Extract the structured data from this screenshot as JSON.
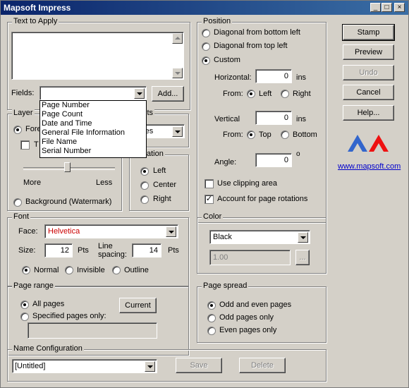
{
  "window": {
    "title": "Mapsoft Impress",
    "minimize_glyph": "_",
    "maximize_glyph": "□",
    "close_glyph": "×"
  },
  "text_to_apply": {
    "label": "Text to Apply",
    "value": ""
  },
  "fields": {
    "label": "Fields:",
    "value": "",
    "add_label": "Add...",
    "options": [
      "Page Number",
      "Page Count",
      "Date and Time",
      "General File Information",
      "File Name",
      "Serial Number"
    ]
  },
  "layer": {
    "label": "Layer",
    "foreground_label": "Fore",
    "t_label": "T",
    "more_label": "More",
    "less_label": "Less",
    "opacity": 0.45,
    "background_label": "Background (Watermark)"
  },
  "units": {
    "label": "its",
    "value": "ches"
  },
  "justification": {
    "label": "stification",
    "left": "Left",
    "center": "Center",
    "right": "Right"
  },
  "position": {
    "label": "Position",
    "diag_bottom_left": "Diagonal from bottom left",
    "diag_top_left": "Diagonal from top left",
    "custom": "Custom",
    "horizontal_label": "Horizontal:",
    "horizontal_value": "0",
    "horizontal_unit": "ins",
    "from_label": "From:",
    "left": "Left",
    "right": "Right",
    "vertical_label": "Vertical",
    "vertical_value": "0",
    "vertical_unit": "ins",
    "from_label2": "From:",
    "top": "Top",
    "bottom": "Bottom",
    "angle_label": "Angle:",
    "angle_value": "0",
    "angle_unit": "o",
    "clipping_label": "Use clipping area",
    "rotations_label": "Account for page rotations"
  },
  "buttons": {
    "stamp": "Stamp",
    "preview": "Preview",
    "undo": "Undo",
    "cancel": "Cancel",
    "help": "Help..."
  },
  "link": "www.mapsoft.com",
  "font": {
    "label": "Font",
    "face_label": "Face:",
    "face_value": "Helvetica",
    "size_label": "Size:",
    "size_value": "12",
    "size_unit": "Pts",
    "spacing_label_1": "Line",
    "spacing_label_2": "spacing:",
    "spacing_value": "14",
    "spacing_unit": "Pts",
    "normal": "Normal",
    "invisible": "Invisible",
    "outline": "Outline"
  },
  "color": {
    "label": "Color",
    "value": "Black",
    "opacity_value": "1.00",
    "ellipsis": "..."
  },
  "page_range": {
    "label": "Page range",
    "all": "All pages",
    "specified": "Specified pages only:",
    "current": "Current",
    "pages_value": ""
  },
  "page_spread": {
    "label": "Page spread",
    "odd_even": "Odd and even pages",
    "odd": "Odd pages only",
    "even": "Even pages only"
  },
  "name_config": {
    "label": "Name Configuration",
    "value": "[Untitled]",
    "save": "Save",
    "delete": "Delete"
  },
  "colors": {
    "title_start": "#0a246a",
    "title_end": "#3a6ea5",
    "face": "#d4d0c8",
    "logo_blue": "#3366cc",
    "logo_red": "#ee1111",
    "font_face_text": "#cc0000"
  }
}
